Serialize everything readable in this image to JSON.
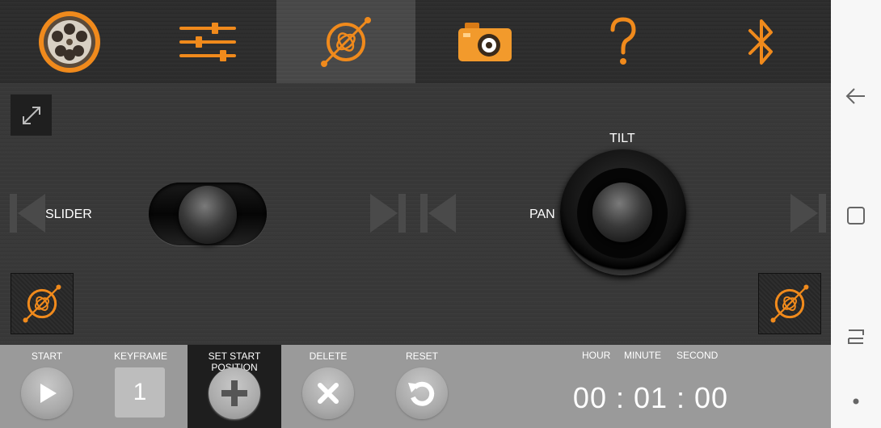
{
  "tabs": [
    {
      "name": "film-reel-icon",
      "active": false
    },
    {
      "name": "sliders-settings-icon",
      "active": false
    },
    {
      "name": "pan-tilt-motion-icon",
      "active": true
    },
    {
      "name": "camera-icon",
      "active": false
    },
    {
      "name": "help-question-icon",
      "active": false
    },
    {
      "name": "bluetooth-icon",
      "active": false
    }
  ],
  "stage": {
    "slider_label": "SLIDER",
    "tilt_label": "TILT",
    "pan_label": "PAN"
  },
  "bottom": {
    "start_label": "START",
    "keyframe_label": "KEYFRAME",
    "keyframe_value": "1",
    "set_start_label": "SET START POSITION",
    "delete_label": "DELETE",
    "reset_label": "RESET",
    "hour_label": "HOUR",
    "minute_label": "MINUTE",
    "second_label": "SECOND",
    "timer": "00 : 01 : 00"
  },
  "colors": {
    "accent": "#f08a1c",
    "accent_dark": "#c4600a",
    "bottom_bar": "#9a9a9a",
    "selected_action": "#1e1e1e"
  }
}
